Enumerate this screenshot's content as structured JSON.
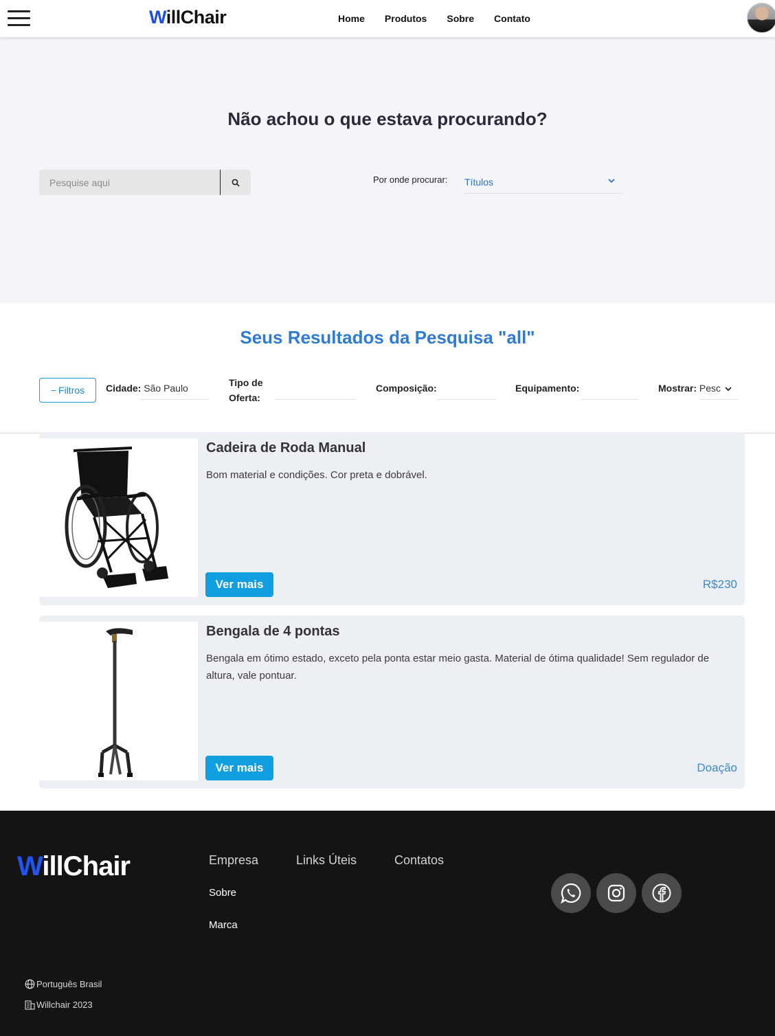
{
  "header": {
    "logo_initial": "W",
    "logo_rest": "illChair",
    "nav": [
      {
        "label": "Home"
      },
      {
        "label": "Produtos"
      },
      {
        "label": "Sobre"
      },
      {
        "label": "Contato"
      }
    ]
  },
  "search": {
    "title": "Não achou o que estava procurando?",
    "placeholder": "Pesquise aqui",
    "where_label": "Por onde procurar:",
    "where_value": "Títulos"
  },
  "results": {
    "title": "Seus Resultados da Pesquisa \"all\"",
    "filters_label": "Filtros",
    "cidade_label": "Cidade:",
    "cidade_value": "São Paulo",
    "tipo_label_1": "Tipo de",
    "tipo_label_2": "Oferta:",
    "composicao_label": "Composição:",
    "equipamento_label": "Equipamento:",
    "mostrar_label": "Mostrar:",
    "mostrar_value": "Pesc"
  },
  "items": [
    {
      "title": "Cadeira de Roda Manual",
      "description": "Bom material e condições. Cor preta e dobrável.",
      "button": "Ver mais",
      "price": "R$230"
    },
    {
      "title": "Bengala de 4 pontas",
      "description": "Bengala em ótimo estado, exceto pela ponta estar meio gasta. Material de ótima qualidade! Sem regulador de altura, vale pontuar.",
      "button": "Ver mais",
      "price": "Doação"
    }
  ],
  "footer": {
    "logo_initial": "W",
    "logo_rest": "illChair",
    "col_empresa": "Empresa",
    "col_links": "Links Úteis",
    "col_contatos": "Contatos",
    "link_sobre": "Sobre",
    "link_marca": "Marca",
    "language": "Português Brasil",
    "copyright": "Willchair 2023",
    "social": [
      "whatsapp-icon",
      "instagram-icon",
      "facebook-icon"
    ]
  },
  "colors": {
    "brand_blue": "#1d4fe8",
    "accent_blue": "#0f9ee0",
    "results_title": "#2f7bd1",
    "footer_bg": "#141414"
  }
}
